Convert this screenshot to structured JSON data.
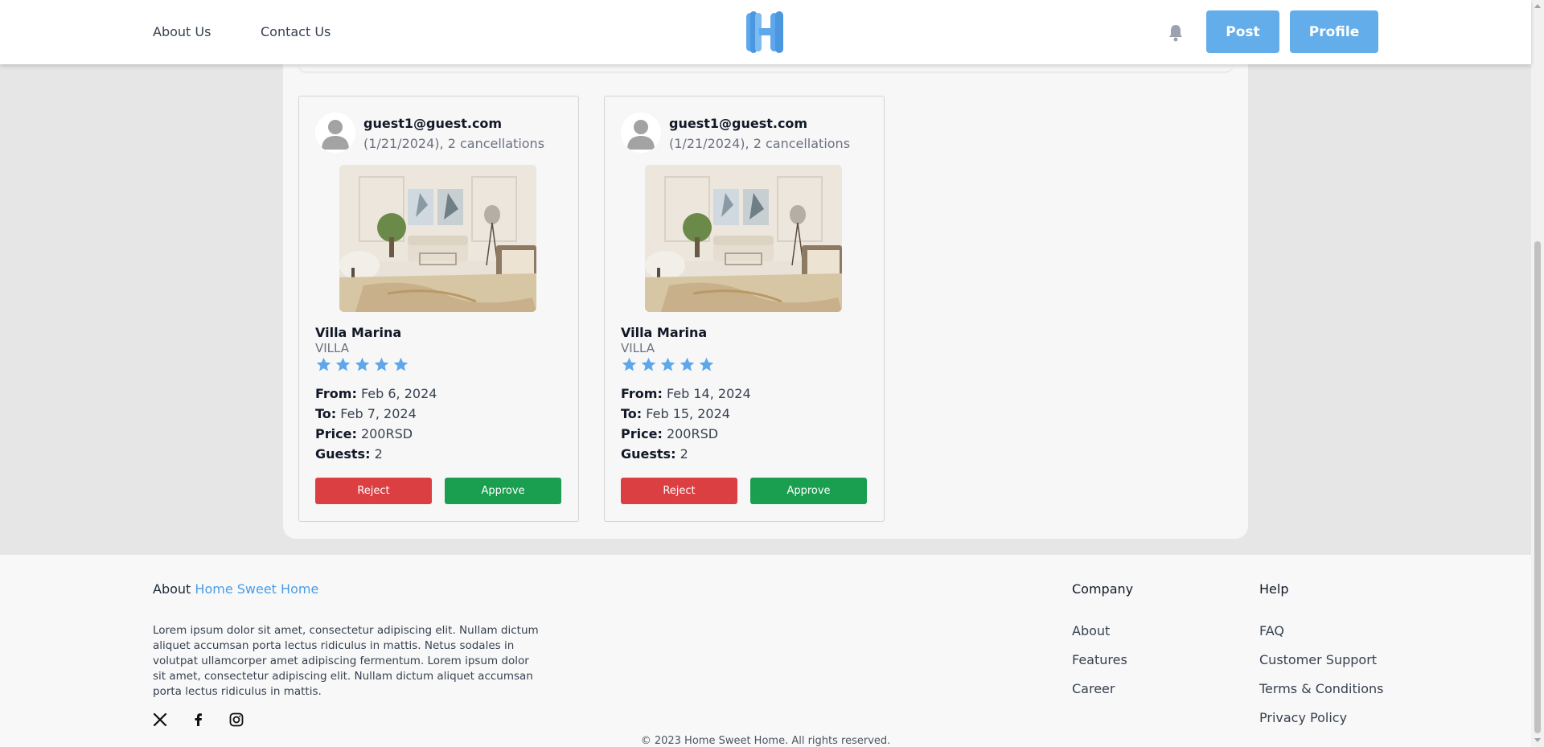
{
  "header": {
    "nav": [
      "About Us",
      "Contact Us"
    ],
    "post_label": "Post",
    "profile_label": "Profile",
    "logo_icon": "home-sweet-home-logo-icon",
    "bell_icon": "bell-icon"
  },
  "colors": {
    "accent": "#63aeea",
    "reject": "#dc3f41",
    "approve": "#1a9e50",
    "star": "#5ea7ea"
  },
  "requests": [
    {
      "email": "guest1@guest.com",
      "meta": "(1/21/2024), 2 cancellations",
      "villa_name": "Villa Marina",
      "villa_type": "VILLA",
      "rating": 5,
      "from_label": "From:",
      "from": "Feb 6, 2024",
      "to_label": "To:",
      "to": "Feb 7, 2024",
      "price_label": "Price:",
      "price": "200RSD",
      "guests_label": "Guests:",
      "guests": "2",
      "reject_label": "Reject",
      "approve_label": "Approve"
    },
    {
      "email": "guest1@guest.com",
      "meta": "(1/21/2024), 2 cancellations",
      "villa_name": "Villa Marina",
      "villa_type": "VILLA",
      "rating": 5,
      "from_label": "From:",
      "from": "Feb 14, 2024",
      "to_label": "To:",
      "to": "Feb 15, 2024",
      "price_label": "Price:",
      "price": "200RSD",
      "guests_label": "Guests:",
      "guests": "2",
      "reject_label": "Reject",
      "approve_label": "Approve"
    }
  ],
  "footer": {
    "about_prefix": "About",
    "about_brand": "Home Sweet Home",
    "about_text": "Lorem ipsum dolor sit amet, consectetur adipiscing elit. Nullam dictum aliquet accumsan porta lectus ridiculus in mattis. Netus sodales in volutpat ullamcorper amet adipiscing fermentum. Lorem ipsum dolor sit amet, consectetur adipiscing elit. Nullam dictum aliquet accumsan porta lectus ridiculus in mattis.",
    "social_icons": [
      "x-icon",
      "facebook-icon",
      "instagram-icon"
    ],
    "company_title": "Company",
    "company_links": [
      "About",
      "Features",
      "Career"
    ],
    "help_title": "Help",
    "help_links": [
      "FAQ",
      "Customer Support",
      "Terms & Conditions",
      "Privacy Policy"
    ],
    "copyright": "© 2023 Home Sweet Home. All rights reserved."
  }
}
